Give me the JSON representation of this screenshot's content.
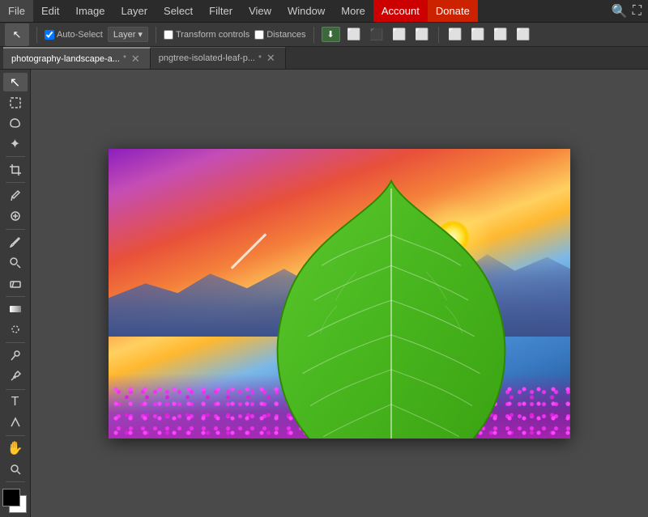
{
  "menubar": {
    "items": [
      "File",
      "Edit",
      "Image",
      "Layer",
      "Select",
      "Filter",
      "View",
      "Window",
      "More"
    ],
    "account_label": "Account",
    "donate_label": "Donate"
  },
  "toolbar": {
    "auto_select_label": "Auto-Select",
    "layer_label": "Layer",
    "transform_controls_label": "Transform controls",
    "distances_label": "Distances"
  },
  "tabs": [
    {
      "name": "photography-landscape-a...*",
      "active": true
    },
    {
      "name": "pngtree-isolated-leaf-p...*",
      "active": false
    }
  ],
  "tools": [
    "move",
    "marquee",
    "lasso",
    "magic-wand",
    "crop",
    "eyedropper",
    "healing",
    "brush",
    "clone",
    "eraser",
    "gradient",
    "blur",
    "dodge",
    "pen",
    "text",
    "path-select",
    "hand",
    "zoom"
  ]
}
